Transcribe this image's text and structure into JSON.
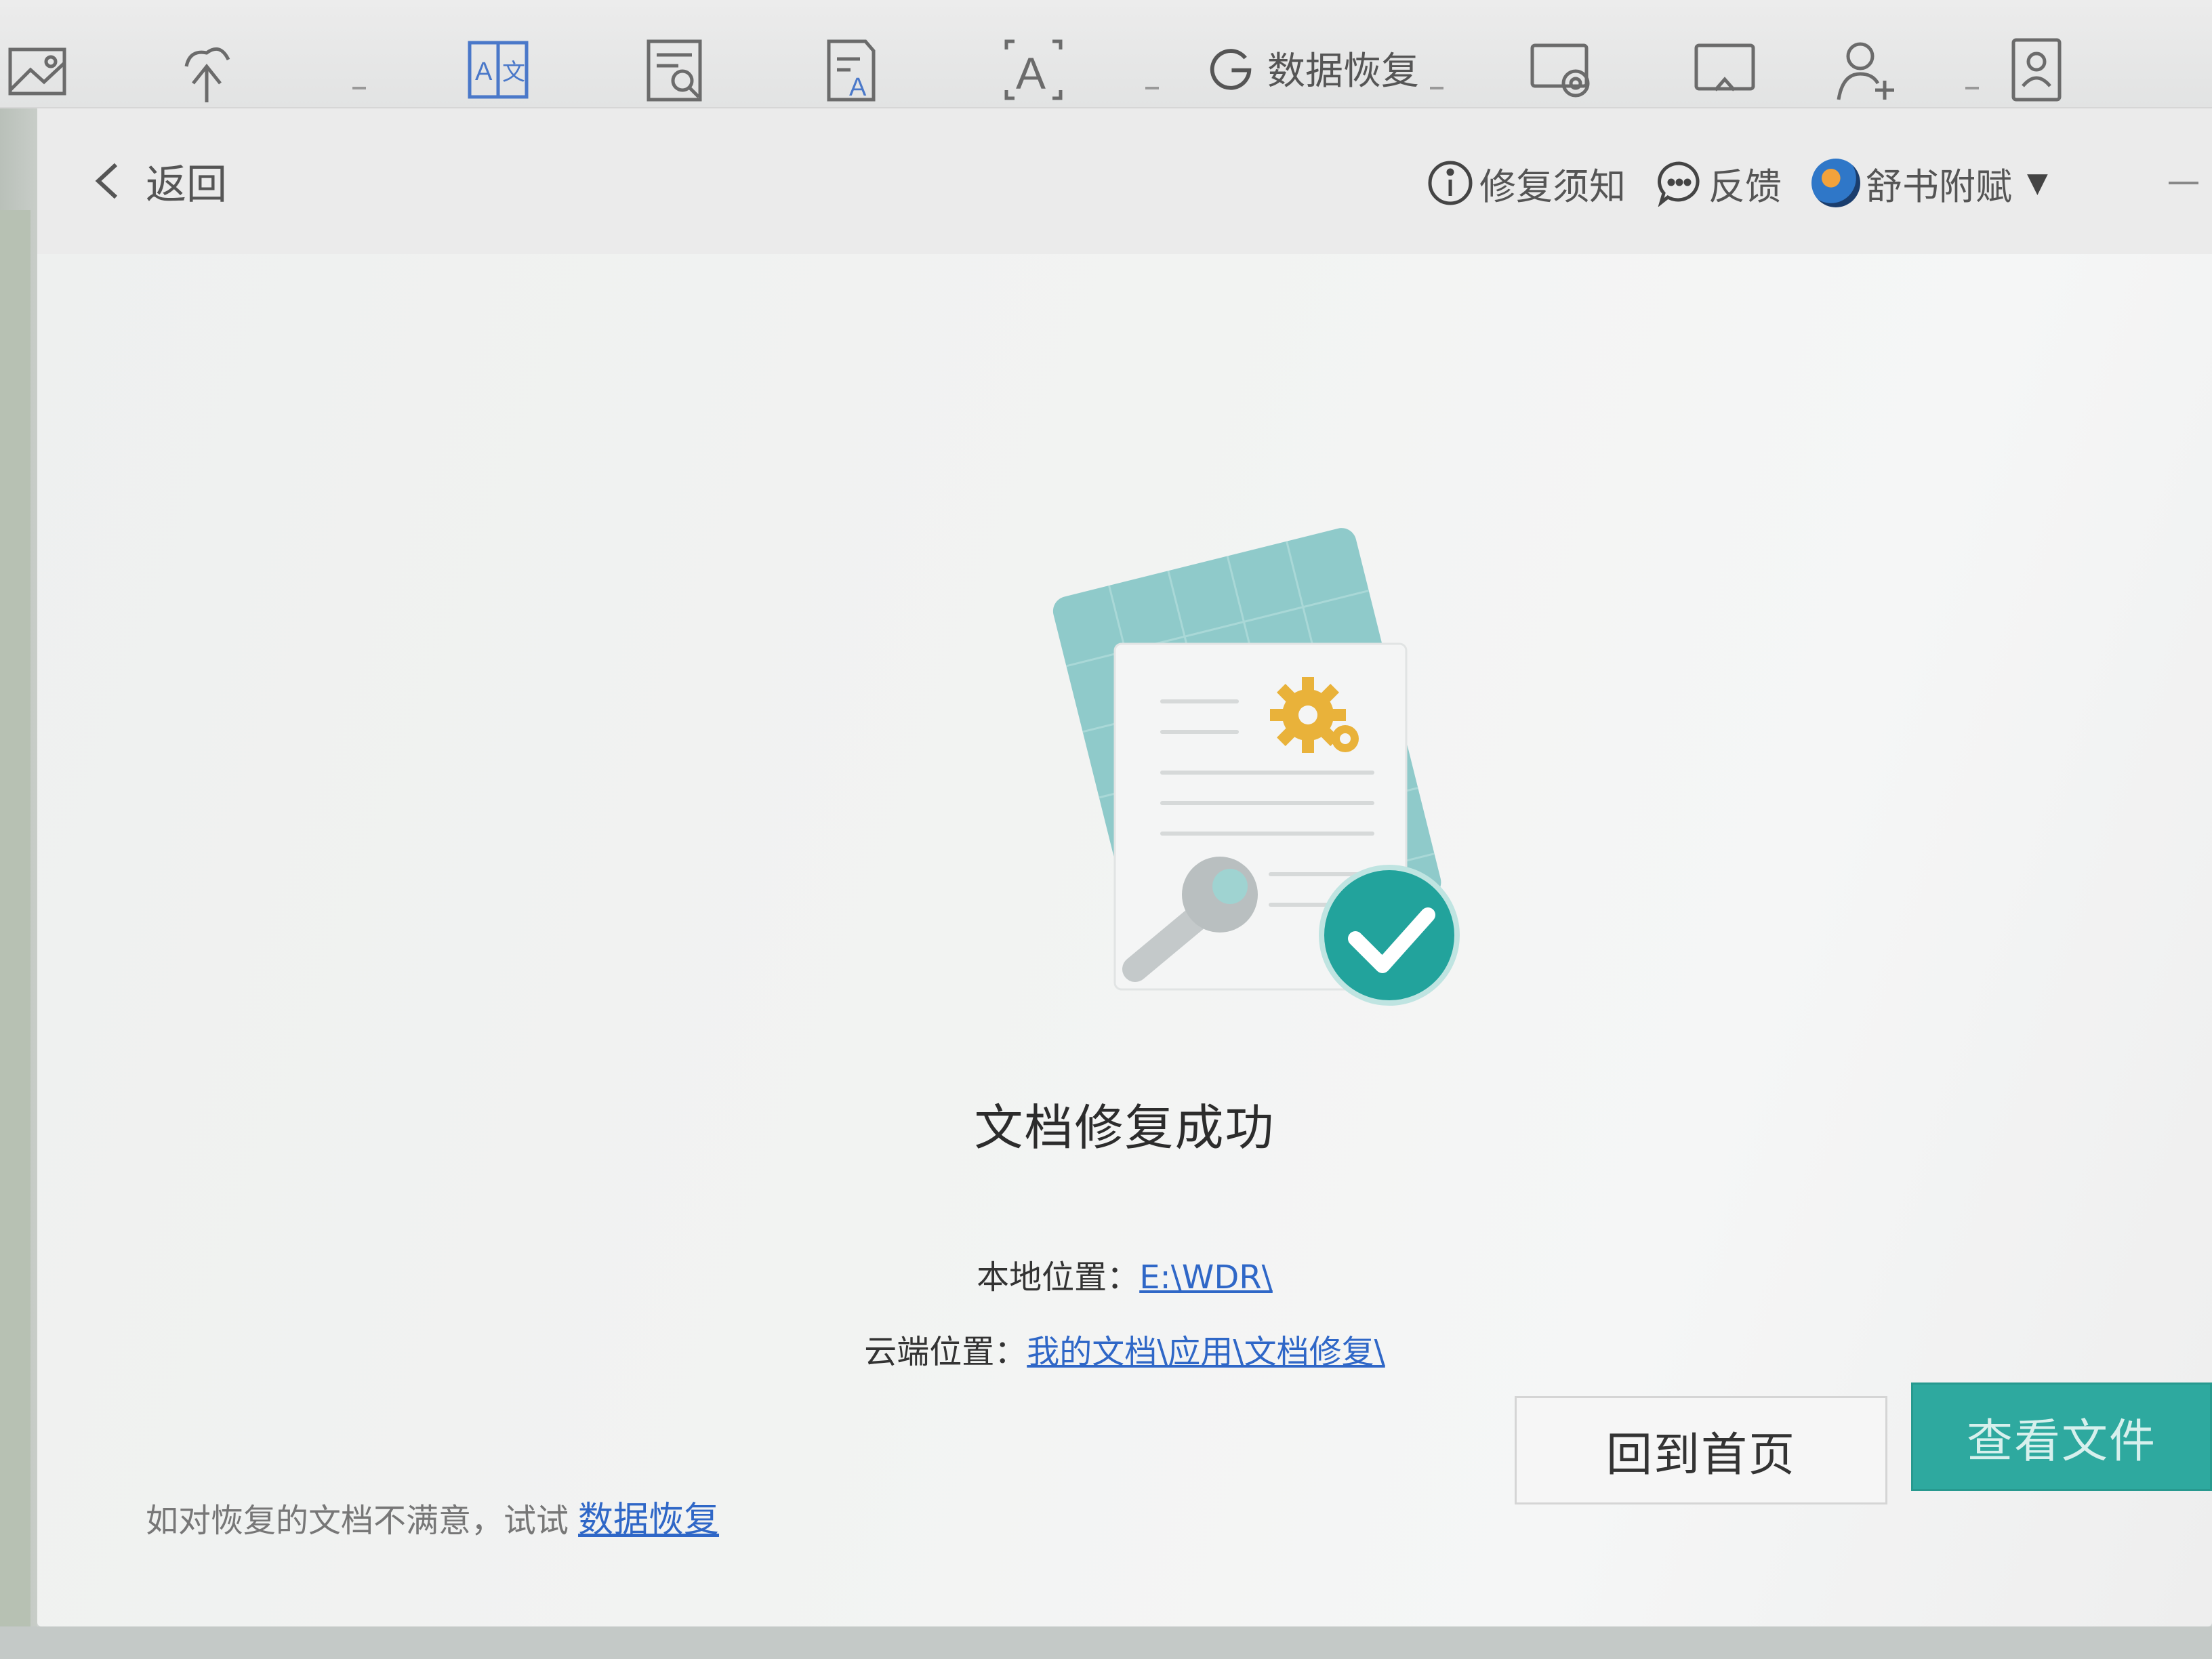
{
  "ribbon": {
    "icons": [
      "image-frame-icon",
      "cloud-upload-icon",
      "translate-icon",
      "document-search-icon",
      "document-font-icon",
      "text-box-icon",
      "screen-record-icon",
      "screenshot-icon",
      "add-user-icon",
      "id-card-icon"
    ],
    "data_recovery_label": "数据恢复"
  },
  "header": {
    "back_label": "返回",
    "notice_label": "修复须知",
    "feedback_label": "反馈",
    "user_name": "舒书附赋"
  },
  "main": {
    "status_title": "文档修复成功",
    "local_label": "本地位置：",
    "local_path": "E:\\WDR\\",
    "cloud_label": "云端位置：",
    "cloud_path": "我的文档\\应用\\文档修复\\",
    "home_button": "回到首页",
    "view_button": "查看文件"
  },
  "footer": {
    "note": "如对恢复的文档不满意，试试",
    "link": "数据恢复"
  },
  "colors": {
    "accent": "#2ea99f",
    "link": "#2f67c7",
    "gear": "#e9b23a"
  }
}
